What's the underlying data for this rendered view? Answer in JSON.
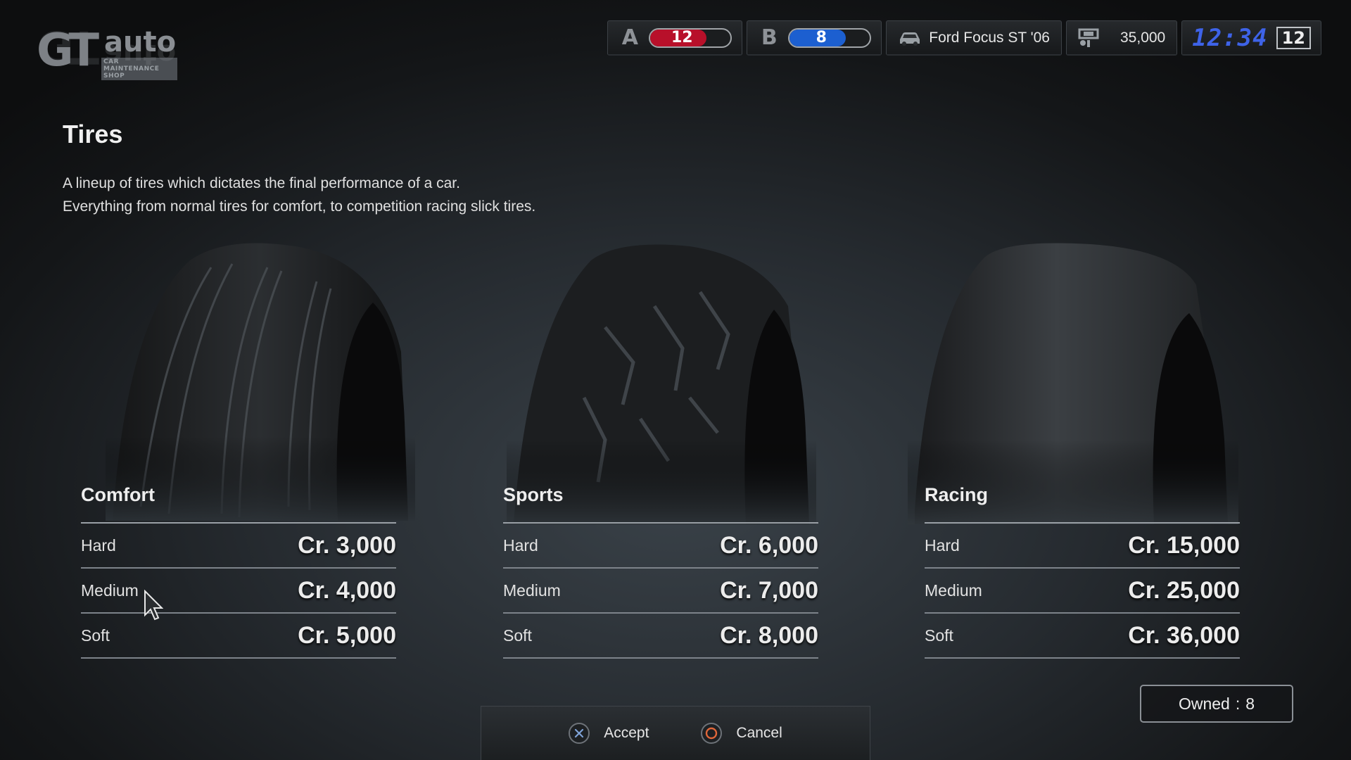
{
  "logo": {
    "main": "GT",
    "auto": "auto",
    "tagline": "CAR MAINTENANCE SHOP"
  },
  "topbar": {
    "a": {
      "letter": "A",
      "value": "12",
      "color": "#b8102a"
    },
    "b": {
      "letter": "B",
      "value": "8",
      "color": "#1c5fd0"
    },
    "car": "Ford Focus ST '06",
    "credits": "35,000",
    "clock": "12:34",
    "day": "12"
  },
  "page": {
    "title": "Tires",
    "description_line1": "A lineup of tires which dictates the final performance of a car.",
    "description_line2": "Everything from normal tires for comfort, to competition racing slick tires."
  },
  "categories": [
    {
      "name": "Comfort",
      "rows": [
        {
          "grade": "Hard",
          "price": "Cr. 3,000"
        },
        {
          "grade": "Medium",
          "price": "Cr. 4,000"
        },
        {
          "grade": "Soft",
          "price": "Cr. 5,000"
        }
      ]
    },
    {
      "name": "Sports",
      "rows": [
        {
          "grade": "Hard",
          "price": "Cr. 6,000"
        },
        {
          "grade": "Medium",
          "price": "Cr. 7,000"
        },
        {
          "grade": "Soft",
          "price": "Cr. 8,000"
        }
      ]
    },
    {
      "name": "Racing",
      "rows": [
        {
          "grade": "Hard",
          "price": "Cr. 15,000"
        },
        {
          "grade": "Medium",
          "price": "Cr. 25,000"
        },
        {
          "grade": "Soft",
          "price": "Cr. 36,000"
        }
      ]
    }
  ],
  "owned": {
    "label": "Owned",
    "separator": ":",
    "value": "8"
  },
  "actions": {
    "accept": "Accept",
    "cancel": "Cancel"
  },
  "icons": {
    "cross": "cross-button-icon",
    "circle": "circle-button-icon",
    "car": "car-icon",
    "credits": "credits-icon",
    "cursor": "mouse-cursor-icon"
  }
}
